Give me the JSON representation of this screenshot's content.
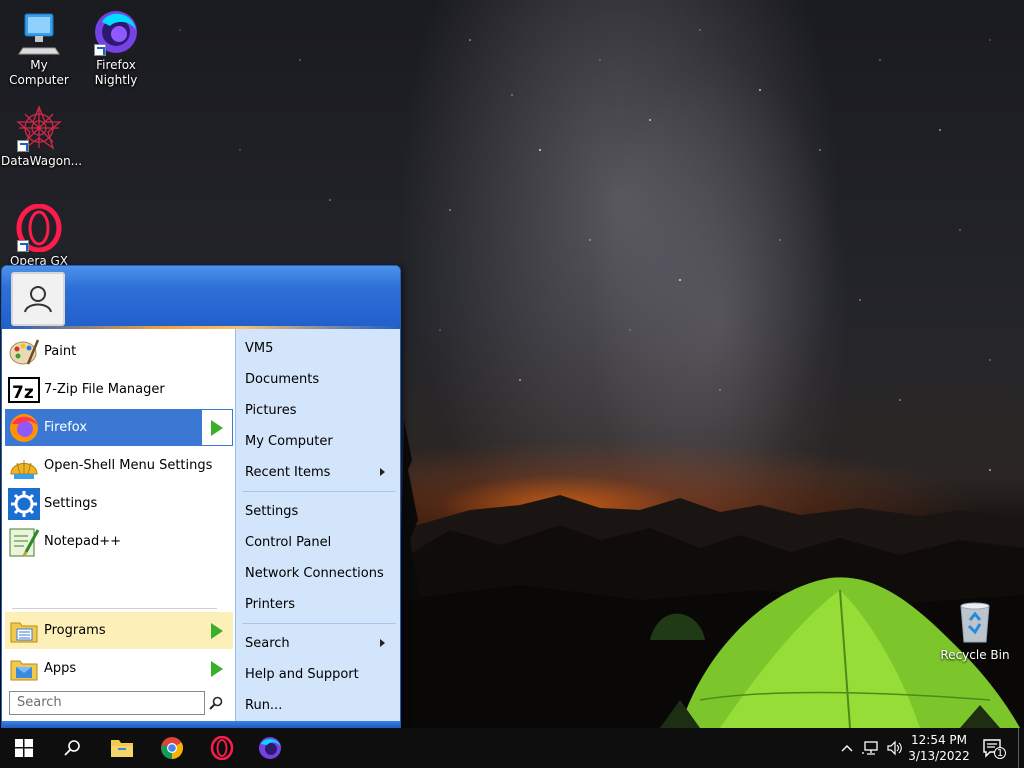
{
  "desktop": {
    "icons": [
      {
        "label": "My Computer"
      },
      {
        "label": "Firefox Nightly"
      },
      {
        "label": "DataWagon..."
      },
      {
        "label": "Opera GX"
      }
    ],
    "recycle_bin": "Recycle Bin"
  },
  "start_menu": {
    "programs": [
      {
        "label": "Paint",
        "icon": "paint-palette-icon"
      },
      {
        "label": "7-Zip File Manager",
        "icon": "7zip-icon"
      },
      {
        "label": "Firefox",
        "icon": "firefox-icon"
      },
      {
        "label": "Open-Shell Menu Settings",
        "icon": "open-shell-icon"
      },
      {
        "label": "Settings",
        "icon": "gear-icon"
      },
      {
        "label": "Notepad++",
        "icon": "notepad-plus-plus-icon"
      }
    ],
    "programs_label": "Programs",
    "apps_label": "Apps",
    "search_placeholder": "Search",
    "links": [
      {
        "label": "VM5"
      },
      {
        "label": "Documents"
      },
      {
        "label": "Pictures"
      },
      {
        "label": "My Computer"
      },
      {
        "label": "Recent Items"
      },
      {
        "label": "Settings"
      },
      {
        "label": "Control Panel"
      },
      {
        "label": "Network Connections"
      },
      {
        "label": "Printers"
      },
      {
        "label": "Search"
      },
      {
        "label": "Help and Support"
      },
      {
        "label": "Run..."
      }
    ]
  },
  "taskbar": {
    "time": "12:54 PM",
    "date": "3/13/2022",
    "notification_count": "1"
  },
  "colors": {
    "start_header": "#215fcb",
    "selection": "#3b78d4",
    "highlight": "#fcf0b8",
    "right_pane": "#d3e5fa"
  }
}
